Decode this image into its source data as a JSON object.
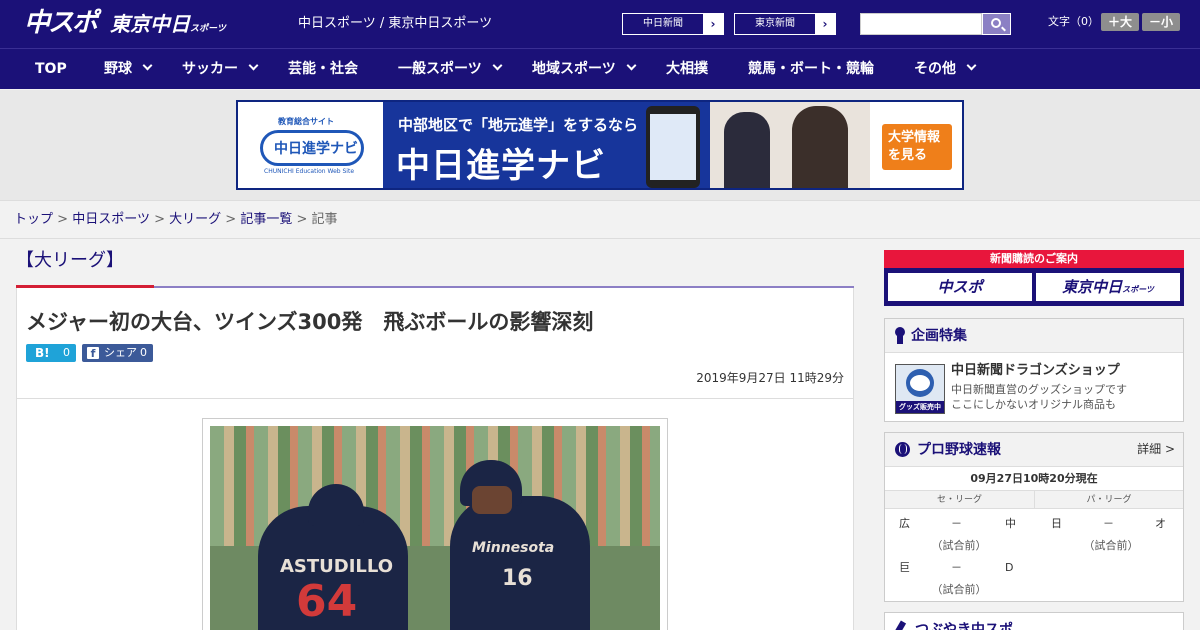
{
  "header": {
    "logo_chuspo": "中スポ",
    "logo_tokyo": "東京中日",
    "logo_tokyo_small": "スポーツ",
    "site_links": "中日スポーツ / 東京中日スポーツ",
    "paper_buttons": [
      {
        "label": "中日新聞",
        "arrow": "›"
      },
      {
        "label": "東京新聞",
        "arrow": "›"
      }
    ],
    "search": {
      "value": "",
      "placeholder": ""
    },
    "font_size_label": "文字（0）",
    "font_larger": "＋大",
    "font_smaller": "－小"
  },
  "nav": {
    "items": [
      {
        "label": "TOP"
      },
      {
        "label": "野球"
      },
      {
        "label": "サッカー"
      },
      {
        "label": "芸能・社会"
      },
      {
        "label": "一般スポーツ"
      },
      {
        "label": "地域スポーツ"
      },
      {
        "label": "大相撲"
      },
      {
        "label": "競馬・ボート・競輪"
      },
      {
        "label": "その他"
      }
    ]
  },
  "banner": {
    "logo_top": "教育総合サイト",
    "logo_name": "中日進学ナビ",
    "logo_sub": "CHUNICHI Education Web Site",
    "line1": "中部地区で「地元進学」をするなら",
    "line2": "中日進学ナビ",
    "cta_line1": "大学情報",
    "cta_line2": "を見る"
  },
  "breadcrumb": {
    "items": [
      "トップ",
      "中日スポーツ",
      "大リーグ",
      "記事一覧"
    ],
    "current": "記事",
    "separator": ">"
  },
  "article": {
    "category": "【大リーグ】",
    "headline": "メジャー初の大台、ツインズ300発　飛ぶボールの影響深刻",
    "hatena": {
      "icon": "B!",
      "count": "0"
    },
    "facebook": {
      "icon": "f",
      "label": "シェア",
      "count": "0"
    },
    "datetime": "2019年9月27日 11時29分",
    "photo": {
      "jersey_name": "ASTUDILLO",
      "jersey_number_left": "64",
      "jersey_number_right": "16",
      "jersey_script": "Minnesota"
    }
  },
  "sidebar": {
    "subscription": {
      "title": "新聞購読のご案内",
      "btn1": "中スポ",
      "btn2": "東京中日",
      "btn2_small": "スポーツ"
    },
    "special": {
      "title": "企画特集",
      "shop_band": "グッズ販売中",
      "shop_title": "中日新聞ドラゴンズショップ",
      "shop_desc1": "中日新聞直営のグッズショップです",
      "shop_desc2": "ここにしかないオリジナル商品も"
    },
    "scores": {
      "title": "プロ野球速報",
      "detail": "詳細 >",
      "time": "09月27日10時20分現在",
      "central": "セ・リーグ",
      "pacific": "パ・リーグ",
      "games": [
        {
          "home": "広",
          "dash": "－",
          "away": "中",
          "status": "（試合前）"
        },
        {
          "home": "日",
          "dash": "－",
          "away": "オ",
          "status": "（試合前）"
        },
        {
          "home": "巨",
          "dash": "－",
          "away": "D",
          "status": "（試合前）"
        }
      ]
    },
    "tsubuyaki": {
      "title": "つぶやき中スポ"
    }
  },
  "colors": {
    "brand_navy": "#1b1178",
    "accent_red": "#d41f35",
    "accent_purple": "#8c7fc5"
  }
}
